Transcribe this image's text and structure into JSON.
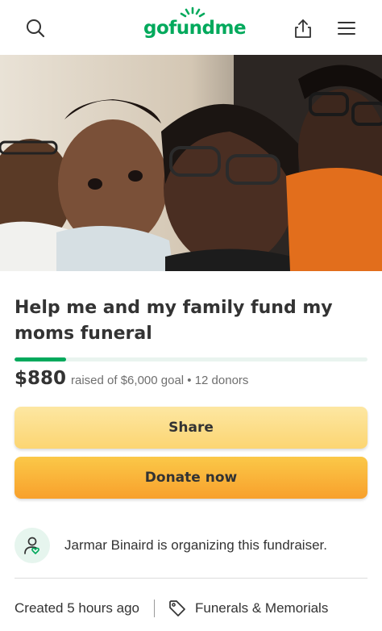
{
  "header": {
    "logo_text": "gofundme",
    "icons": {
      "search": "search-icon",
      "share": "share-upload-icon",
      "menu": "hamburger-menu-icon"
    },
    "brand_color": "#02a95c"
  },
  "hero": {
    "image": "photo of a smiling family: woman with glasses, baby, two boys"
  },
  "campaign": {
    "title": "Help me and my family fund my moms funeral",
    "amount_raised": "$880",
    "raised_suffix": "raised of $6,000 goal • 12 donors",
    "progress_fraction": 0.147
  },
  "actions": {
    "share_label": "Share",
    "donate_label": "Donate now"
  },
  "organizer": {
    "text": "Jarmar Binaird is organizing this fundraiser.",
    "icon": "user-heart-icon"
  },
  "meta": {
    "created": "Created 5 hours ago",
    "category": "Funerals & Memorials",
    "category_icon": "tag-icon"
  }
}
